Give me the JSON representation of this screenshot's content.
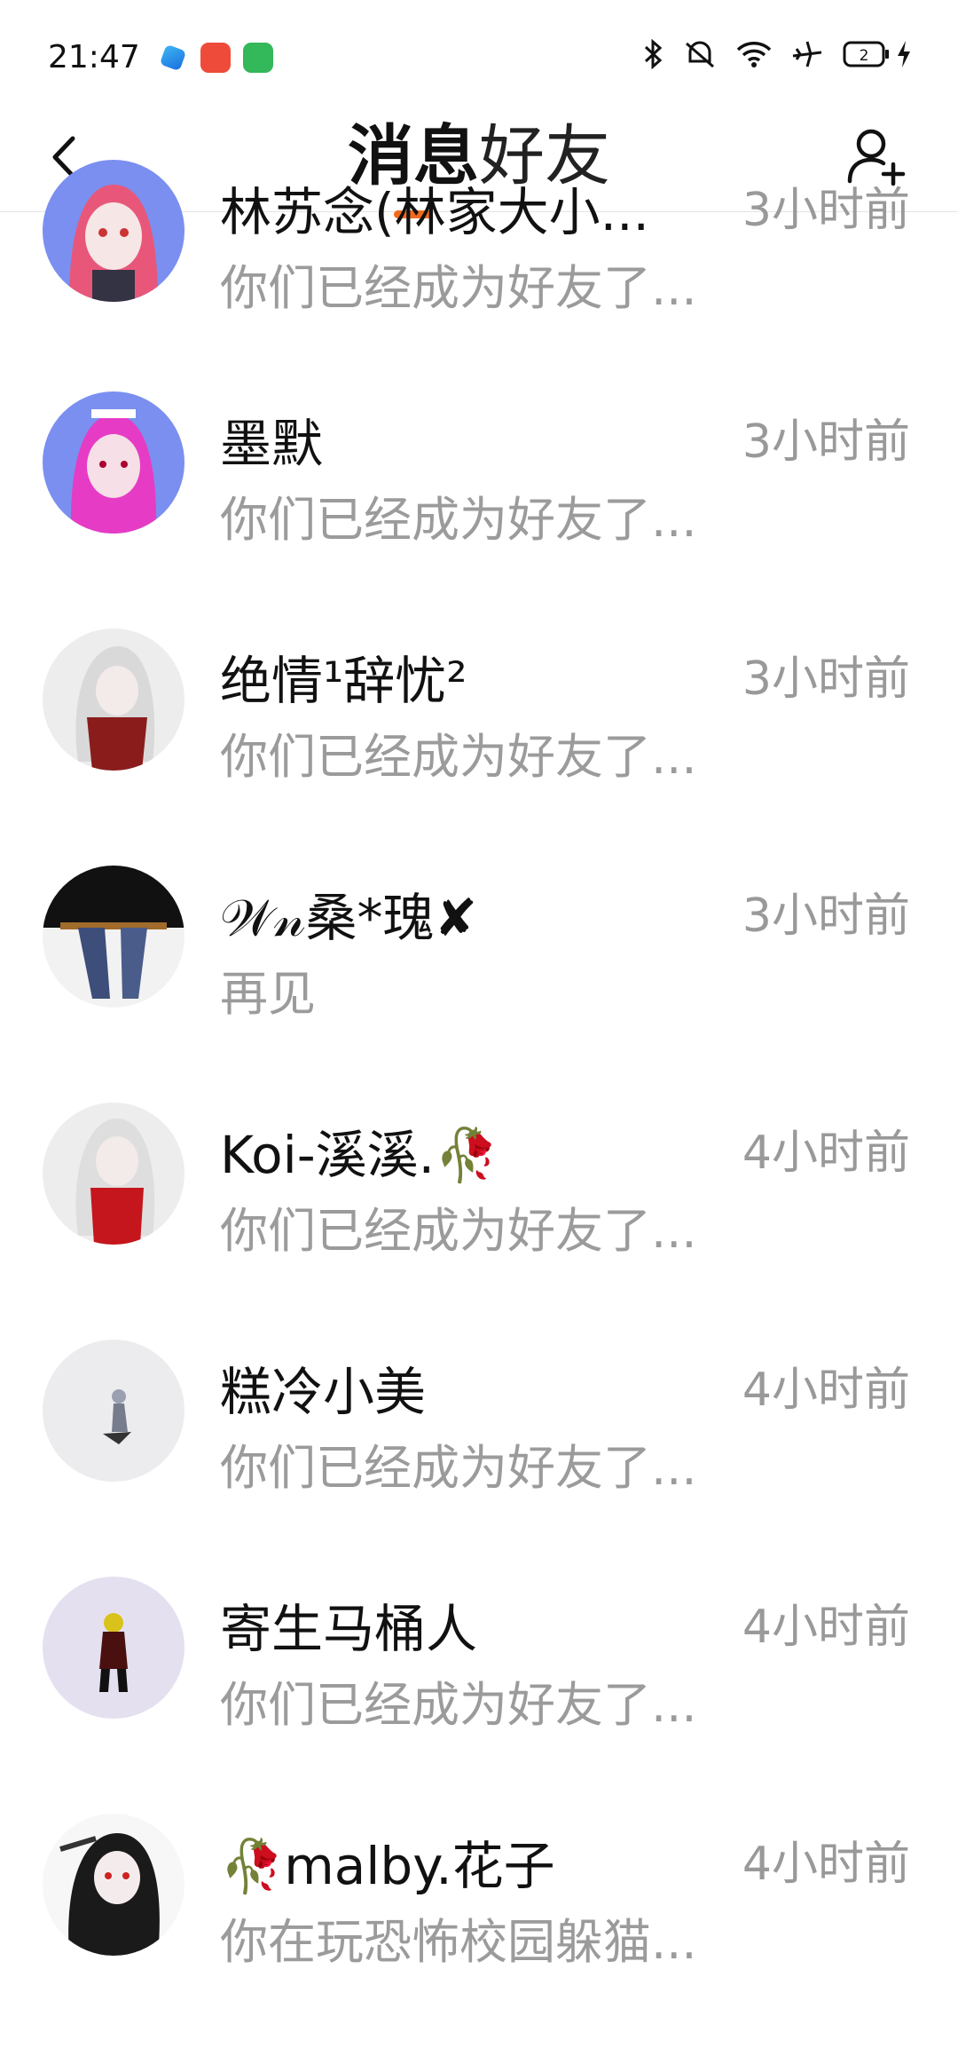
{
  "status_bar": {
    "time": "21:47",
    "battery": "2",
    "icons": [
      "bluetooth-icon",
      "mute-icon",
      "wifi-icon",
      "airplane-icon",
      "battery-icon",
      "charging-icon"
    ]
  },
  "header": {
    "tabs": [
      {
        "label": "消息",
        "active": true
      },
      {
        "label": "好友",
        "active": false
      }
    ],
    "accent_color": "#f26b1d"
  },
  "friends": [
    {
      "name": "林苏念(林家大小...",
      "time": "3小时前",
      "message": "你们已经成为好友了..."
    },
    {
      "name": "墨默",
      "time": "3小时前",
      "message": "你们已经成为好友了..."
    },
    {
      "name": "绝情¹辞忧²",
      "time": "3小时前",
      "message": "你们已经成为好友了..."
    },
    {
      "name": "𝒲𝓃桑*瑰✘",
      "time": "3小时前",
      "message": "再见"
    },
    {
      "name": "Koi-溪溪.🥀",
      "time": "4小时前",
      "message": "你们已经成为好友了..."
    },
    {
      "name": "糕冷小美",
      "time": "4小时前",
      "message": "你们已经成为好友了..."
    },
    {
      "name": "寄生马桶人",
      "time": "4小时前",
      "message": "你们已经成为好友了..."
    },
    {
      "name": "🥀malby.花子",
      "time": "4小时前",
      "message": "你在玩恐怖校园躲猫..."
    }
  ]
}
